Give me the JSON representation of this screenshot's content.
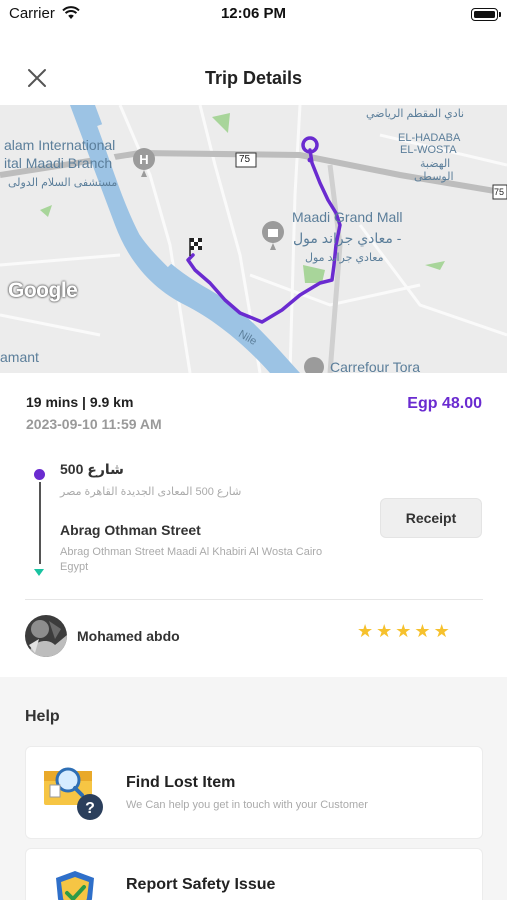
{
  "status_bar": {
    "carrier": "Carrier",
    "time": "12:06 PM"
  },
  "nav": {
    "title": "Trip Details"
  },
  "map": {
    "labels": {
      "hospital_en_1": "alam International",
      "hospital_en_2": "ital Maadi Branch",
      "hospital_ar": "مستشفى السلام الدولى",
      "club_ar": "نادي المقطم الرياضي",
      "hadaba_1": "EL-HADABA",
      "hadaba_2": "EL-WOSTA",
      "hadaba_ar_1": "الهضبة",
      "hadaba_ar_2": "الوسطى",
      "mall_en": "Maadi Grand Mall",
      "mall_ar_1": "معادي جراند مول -",
      "mall_ar_2": "معادي جراند مول",
      "road_badge_1": "75",
      "road_badge_2": "75",
      "nile": "Nile",
      "amant": "amant",
      "carrefour": "Carrefour Tora",
      "google": "Google"
    }
  },
  "trip": {
    "duration_distance": "19 mins | 9.9 km",
    "datetime": "2023-09-10 11:59 AM",
    "price": "Egp 48.00"
  },
  "route": {
    "pickup_name": "شارع 500",
    "pickup_address": "شارع 500 المعادى الجديدة القاهرة مصر",
    "dropoff_name": "Abrag Othman Street",
    "dropoff_address": "Abrag Othman Street Maadi Al Khabiri Al Wosta Cairo Egypt"
  },
  "receipt_label": "Receipt",
  "driver": {
    "name": "Mohamed abdo",
    "rating": 5,
    "rating_max": 5
  },
  "help": {
    "title": "Help",
    "items": [
      {
        "title": "Find Lost Item",
        "subtitle": "We Can help you get in touch with your Customer",
        "icon": "lost-item-icon"
      },
      {
        "title": "Report Safety Issue",
        "subtitle": "",
        "icon": "safety-shield-icon"
      }
    ]
  },
  "colors": {
    "accent": "#6a2bd0",
    "dropoff": "#19c3a1",
    "star": "#f6c12d"
  }
}
